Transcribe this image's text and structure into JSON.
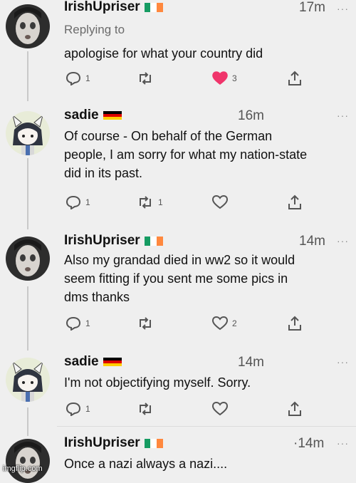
{
  "tweets": [
    {
      "user": "IrishUpriser",
      "flag": "ireland",
      "time": "17m",
      "replying_to": "Replying to",
      "lines": [
        "apologise for what your country did"
      ],
      "actions": {
        "replies": "1",
        "retweets": "",
        "likes": "3",
        "liked": true
      }
    },
    {
      "user": "sadie",
      "flag": "germany",
      "time": "16m",
      "lines": [
        "Of course - On behalf of the German",
        "people, I am sorry for what my nation-state",
        "did in its past."
      ],
      "actions": {
        "replies": "1",
        "retweets": "1",
        "likes": "",
        "liked": false
      }
    },
    {
      "user": "IrishUpriser",
      "flag": "ireland",
      "time": "14m",
      "lines": [
        "Also my grandad died in ww2 so it would",
        "seem fitting if you sent me some pics in",
        "dms thanks"
      ],
      "actions": {
        "replies": "1",
        "retweets": "",
        "likes": "2",
        "liked": false
      }
    },
    {
      "user": "sadie",
      "flag": "germany",
      "time": "14m",
      "lines": [
        "I'm not objectifying myself. Sorry."
      ],
      "actions": {
        "replies": "1",
        "retweets": "",
        "likes": "",
        "liked": false
      }
    },
    {
      "user": "IrishUpriser",
      "flag": "ireland",
      "time": "·14m",
      "lines": [
        "Once a nazi always a nazi...."
      ],
      "actions": null
    }
  ],
  "more_glyph": "···",
  "watermark": "imgflip.com",
  "colors": {
    "background": "#efefef",
    "like_active": "#f0356b",
    "icon": "#555555",
    "flag_ireland": [
      "#169b62",
      "#ffffff",
      "#ff883e"
    ],
    "flag_germany": [
      "#000000",
      "#dd0000",
      "#ffce00"
    ]
  },
  "icons": {
    "reply": "reply-icon",
    "retweet": "retweet-icon",
    "like": "heart-icon",
    "share": "share-icon"
  }
}
